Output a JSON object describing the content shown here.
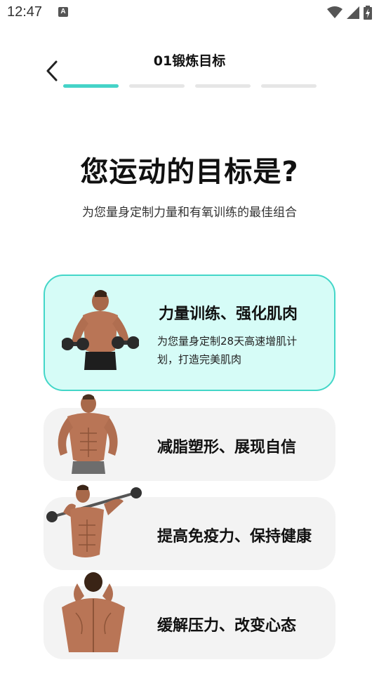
{
  "status": {
    "time": "12:47",
    "a_badge": "A"
  },
  "header": {
    "title": "01锻炼目标"
  },
  "progress": {
    "current_step": 1,
    "total_steps": 4
  },
  "question": {
    "title": "您运动的目标是?",
    "subtitle": "为您量身定制力量和有氧训练的最佳组合"
  },
  "options": [
    {
      "title": "力量训练、强化肌肉",
      "desc": "为您量身定制28天高速增肌计划，打造完美肌肉",
      "selected": true,
      "icon": "dumbbell-man-image"
    },
    {
      "title": "减脂塑形、展现自信",
      "selected": false,
      "icon": "muscle-pose-man-image"
    },
    {
      "title": "提高免疫力、保持健康",
      "selected": false,
      "icon": "barbell-man-image"
    },
    {
      "title": "缓解压力、改变心态",
      "selected": false,
      "icon": "back-view-man-image"
    }
  ],
  "colors": {
    "accent": "#45d3c8",
    "selected_bg": "#d6fcf7",
    "card_bg": "#f3f3f3"
  }
}
